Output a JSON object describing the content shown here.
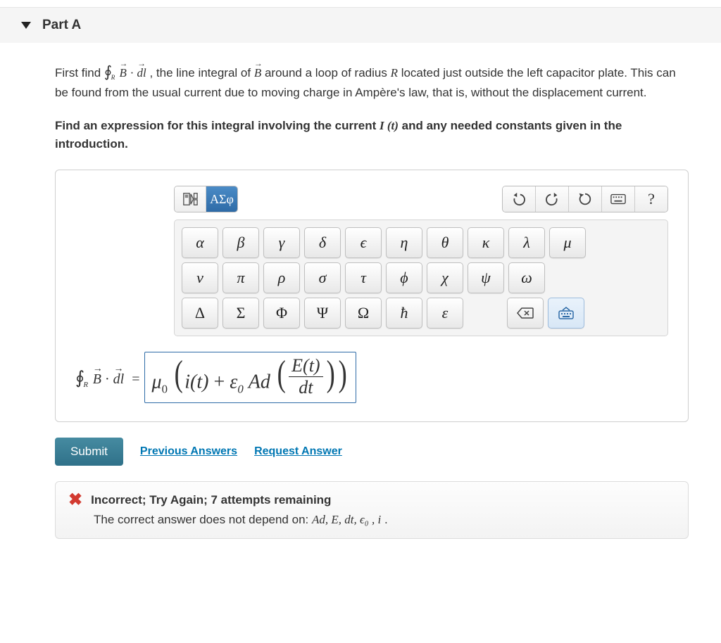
{
  "part_label": "Part A",
  "problem": {
    "before_expr": "First find ",
    "after_expr": ", the line integral of ",
    "after_B": " around a loop of radius ",
    "after_R": " located just outside the left capacitor plate. This can be found from the usual current due to moving charge in Ampère's law, that is, without the displacement current."
  },
  "instruction": {
    "before_I": "Find an expression for this integral involving the current ",
    "after_I": " and any needed constants given in the introduction."
  },
  "toolbar": {
    "greek_label": "ΑΣφ"
  },
  "greek_keys": {
    "row1": [
      "α",
      "β",
      "γ",
      "δ",
      "ϵ",
      "η",
      "θ",
      "κ",
      "λ",
      "μ"
    ],
    "row2": [
      "ν",
      "π",
      "ρ",
      "σ",
      "τ",
      "ϕ",
      "χ",
      "ψ",
      "ω"
    ],
    "row3": [
      "Δ",
      "Σ",
      "Φ",
      "Ψ",
      "Ω",
      "ħ",
      "ε"
    ]
  },
  "answer": {
    "lhs_oint_sub": "R",
    "lhs_B": "B",
    "lhs_dl": "dl",
    "mu": "μ",
    "mu_sub": "0",
    "it": "i(t)",
    "plus": " + ",
    "eps": "ε",
    "eps_sub": "0",
    "Ad": "Ad",
    "frac_num_E": "E(t)",
    "frac_den": "dt"
  },
  "actions": {
    "submit": "Submit",
    "prev": "Previous Answers",
    "request": "Request Answer"
  },
  "feedback": {
    "line1": "Incorrect; Try Again; 7 attempts remaining",
    "line2_before": "The correct answer does not depend on: ",
    "line2_vars": "Ad, E, dt, ϵ₀ , i",
    "line2_after": "."
  }
}
